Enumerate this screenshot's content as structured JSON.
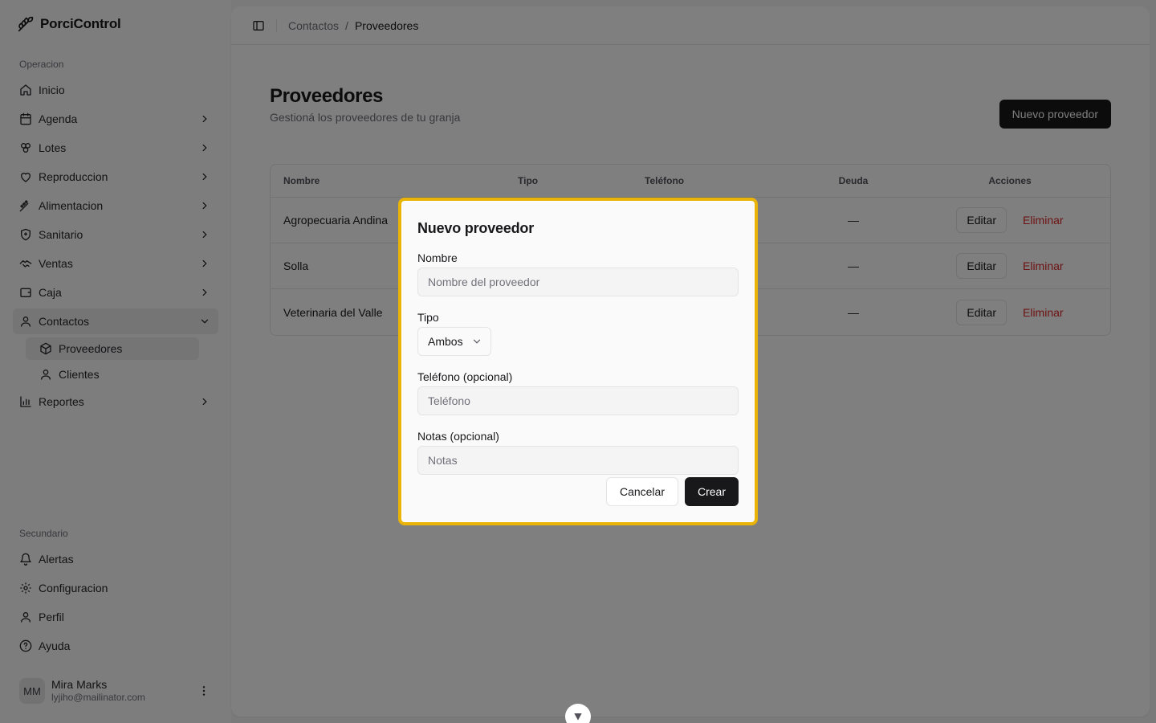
{
  "app": {
    "name": "PorciControl"
  },
  "sidebar": {
    "group_primary": "Operacion",
    "group_secondary": "Secundario",
    "items": [
      {
        "label": "Inicio",
        "icon": "home-icon"
      },
      {
        "label": "Agenda",
        "icon": "calendar-icon"
      },
      {
        "label": "Lotes",
        "icon": "boxes-icon"
      },
      {
        "label": "Reproduccion",
        "icon": "heart-icon"
      },
      {
        "label": "Alimentacion",
        "icon": "wheat-icon"
      },
      {
        "label": "Sanitario",
        "icon": "shield-icon"
      },
      {
        "label": "Ventas",
        "icon": "handshake-icon"
      },
      {
        "label": "Caja",
        "icon": "wallet-icon"
      },
      {
        "label": "Contactos",
        "icon": "user-icon"
      },
      {
        "label": "Reportes",
        "icon": "bar-chart-icon"
      }
    ],
    "contactos_sub": [
      {
        "label": "Proveedores",
        "icon": "package-icon"
      },
      {
        "label": "Clientes",
        "icon": "user-icon"
      }
    ],
    "secondary_items": [
      {
        "label": "Alertas",
        "icon": "bell-icon"
      },
      {
        "label": "Configuracion",
        "icon": "gear-icon"
      },
      {
        "label": "Perfil",
        "icon": "user-icon"
      },
      {
        "label": "Ayuda",
        "icon": "help-icon"
      }
    ],
    "user": {
      "initials": "MM",
      "name": "Mira Marks",
      "email": "lyjiho@mailinator.com"
    }
  },
  "breadcrumb": {
    "parent": "Contactos",
    "separator": "/",
    "current": "Proveedores"
  },
  "page": {
    "title": "Proveedores",
    "subtitle": "Gestioná los proveedores de tu granja",
    "new_button": "Nuevo proveedor"
  },
  "table": {
    "headers": [
      "Nombre",
      "Tipo",
      "Teléfono",
      "Deuda",
      "Acciones"
    ],
    "rows": [
      {
        "nombre": "Agropecuaria Andina",
        "deuda": "—"
      },
      {
        "nombre": "Solla",
        "deuda": "—"
      },
      {
        "nombre": "Veterinaria del Valle",
        "deuda": "—"
      }
    ],
    "edit_label": "Editar",
    "delete_label": "Eliminar"
  },
  "modal": {
    "title": "Nuevo proveedor",
    "nombre_label": "Nombre",
    "nombre_placeholder": "Nombre del proveedor",
    "tipo_label": "Tipo",
    "tipo_value": "Ambos",
    "telefono_label": "Teléfono (opcional)",
    "telefono_placeholder": "Teléfono",
    "notas_label": "Notas (opcional)",
    "notas_placeholder": "Notas",
    "cancel": "Cancelar",
    "create": "Crear"
  },
  "colors": {
    "accent": "#18181b",
    "danger": "#dc2626",
    "highlight": "#eab308"
  }
}
